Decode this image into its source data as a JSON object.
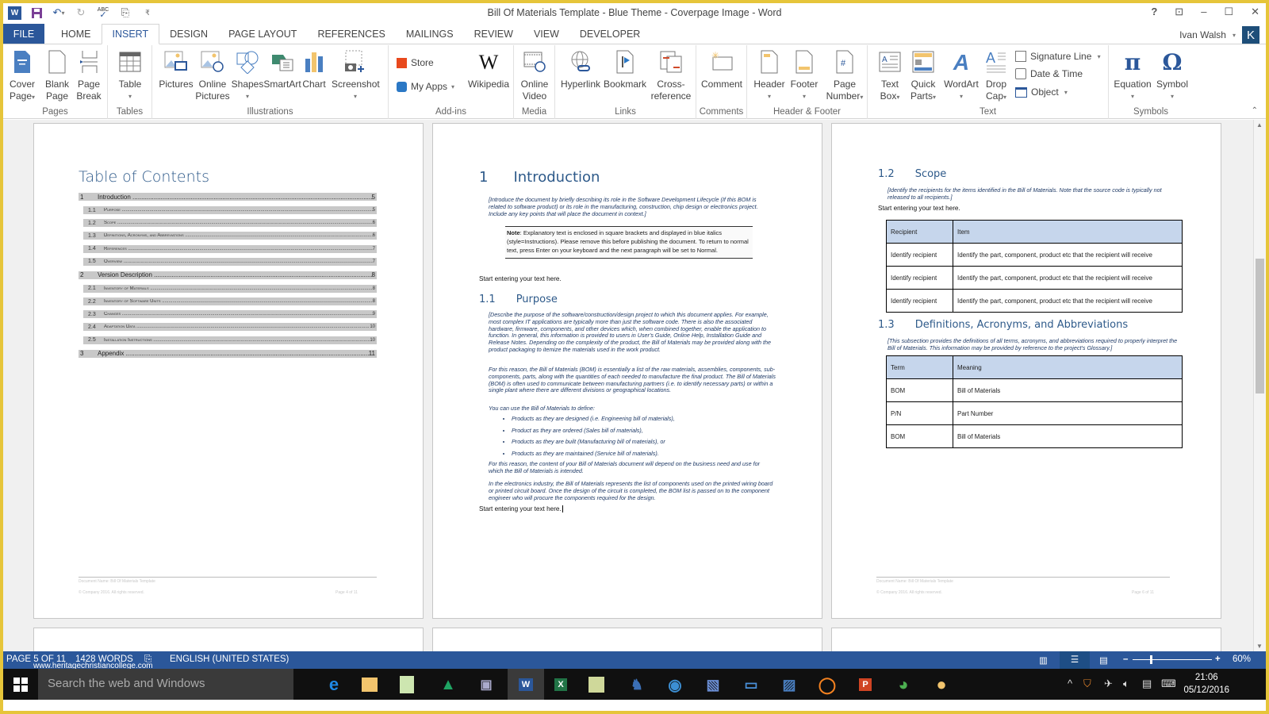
{
  "window": {
    "title": "Bill Of Materials Template - Blue Theme - Coverpage Image - Word",
    "controls": [
      "?",
      "ribbon-display-options",
      "minimize",
      "maximize",
      "close"
    ]
  },
  "qat": {
    "icons": [
      "word-logo",
      "save-icon",
      "undo-icon",
      "redo-icon",
      "spelling-icon",
      "touch-mode-icon",
      "customize-qat-icon"
    ]
  },
  "tabs": [
    "FILE",
    "HOME",
    "INSERT",
    "DESIGN",
    "PAGE LAYOUT",
    "REFERENCES",
    "MAILINGS",
    "REVIEW",
    "VIEW",
    "DEVELOPER"
  ],
  "active_tab": "INSERT",
  "user": {
    "name": "Ivan Walsh",
    "initial": "K"
  },
  "ribbon": {
    "groups": {
      "pages": "Pages",
      "tables": "Tables",
      "illustrations": "Illustrations",
      "addins": "Add-ins",
      "media": "Media",
      "links": "Links",
      "comments": "Comments",
      "header_footer": "Header & Footer",
      "text": "Text",
      "symbols": "Symbols"
    },
    "buttons": {
      "cover_page": [
        "Cover",
        "Page"
      ],
      "blank_page": [
        "Blank",
        "Page"
      ],
      "page_break": [
        "Page",
        "Break"
      ],
      "table": "Table",
      "pictures": "Pictures",
      "online_pictures": [
        "Online",
        "Pictures"
      ],
      "shapes": "Shapes",
      "smartart": "SmartArt",
      "chart": "Chart",
      "screenshot": "Screenshot",
      "store": "Store",
      "my_apps": "My Apps",
      "wikipedia": "Wikipedia",
      "online_video": [
        "Online",
        "Video"
      ],
      "hyperlink": "Hyperlink",
      "bookmark": "Bookmark",
      "cross_reference": [
        "Cross-",
        "reference"
      ],
      "comment": "Comment",
      "header": "Header",
      "footer": "Footer",
      "page_number": [
        "Page",
        "Number"
      ],
      "text_box": [
        "Text",
        "Box"
      ],
      "quick_parts": [
        "Quick",
        "Parts"
      ],
      "wordart": "WordArt",
      "drop_cap": [
        "Drop",
        "Cap"
      ],
      "signature_line": "Signature Line",
      "date_time": "Date & Time",
      "object": "Object",
      "equation": "Equation",
      "symbol": "Symbol"
    }
  },
  "page4": {
    "heading": "Table of Contents",
    "toc": [
      {
        "num": "1",
        "text": "Introduction",
        "page": "5",
        "level": 1
      },
      {
        "num": "1.1",
        "text": "Purpose",
        "page": "5",
        "level": 2
      },
      {
        "num": "1.2",
        "text": "Scope",
        "page": "6",
        "level": 2
      },
      {
        "num": "1.3",
        "text": "Definitions, Acronyms, and Abbreviations",
        "page": "6",
        "level": 2
      },
      {
        "num": "1.4",
        "text": "References",
        "page": "7",
        "level": 2
      },
      {
        "num": "1.5",
        "text": "Overview",
        "page": "7",
        "level": 2
      },
      {
        "num": "2",
        "text": "Version Description",
        "page": "8",
        "level": 1
      },
      {
        "num": "2.1",
        "text": "Inventory of Materials",
        "page": "8",
        "level": 2
      },
      {
        "num": "2.2",
        "text": "Inventory of Software Units",
        "page": "8",
        "level": 2
      },
      {
        "num": "2.3",
        "text": "Changes",
        "page": "9",
        "level": 2
      },
      {
        "num": "2.4",
        "text": "Adaptation Data",
        "page": "10",
        "level": 2
      },
      {
        "num": "2.5",
        "text": "Installation Instructions",
        "page": "10",
        "level": 2
      },
      {
        "num": "3",
        "text": "Appendix",
        "page": "11",
        "level": 1
      }
    ],
    "footer_name": "Document Name: Bill Of Materials Template",
    "footer_copy": "© Company 2016. All rights reserved.",
    "footer_page": "Page 4 of 11"
  },
  "page5": {
    "h1_num": "1",
    "h1_text": "Introduction",
    "intro_instr": "[Introduce the document by briefly describing its role in the Software Development Lifecycle (If this BOM is related to software product) or its role in the manufacturing, construction, chip design or electronics project. Include any key points that will place the document in context.]",
    "note_label": "Note",
    "note_text": ": Explanatory text is enclosed in square brackets and displayed in blue italics (style=Instructions). Please remove this before publishing the document. To return to normal text, press Enter on your keyboard and the next paragraph will be set to Normal.",
    "start_text": "Start entering your text here.",
    "h2_num": "1.1",
    "h2_text": "Purpose",
    "purpose_p1": "[Describe the purpose of the software/construction/design project to which this document applies. For example, most complex IT applications are typically more than just the software code. There is also the associated hardware, firmware, components, and other devices which, when combined together, enable the application to function. In general, this information is provided to users in User's Guide, Online Help, Installation Guide and Release Notes. Depending on the complexity of the product, the Bill of Materials may be provided along with the product packaging to itemize the materials used in the work product.",
    "purpose_p2": "For this reason, the Bill of Materials (BOM) is essentially a list of the raw materials, assemblies, components, sub-components, parts, along with the quantities of each needed to manufacture the final product. The Bill of Materials (BOM) is often used to communicate between manufacturing partners (i.e. to identify necessary parts) or within a single plant where there are different divisions or geographical locations.",
    "purpose_p3": "You can use the Bill of Materials to define:",
    "bullets": [
      "Products as they are designed (i.e. Engineering bill of materials),",
      "Product as they are ordered (Sales bill of materials),",
      "Products as they are built (Manufacturing bill of materials), or",
      "Products as they are maintained (Service bill of materials)."
    ],
    "purpose_p4": "For this reason, the content of your Bill of Materials document will depend on the business need and use for which the Bill of Materials is intended.",
    "purpose_p5": "In the electronics industry, the Bill of Materials represents the list of components used on the printed wiring board or printed circuit board. Once the design of the circuit is completed, the BOM list is passed on to the component engineer who will procure the components required for the design.",
    "start_text2": "Start entering your text here."
  },
  "page6": {
    "scope_num": "1.2",
    "scope_text": "Scope",
    "scope_instr": "[Identify the recipients for the items identified in the Bill of Materials. Note that the source code is typically not released to all recipients.]",
    "start_text": "Start entering your text here.",
    "recipients_table": {
      "headers": [
        "Recipient",
        "Item"
      ],
      "rows": [
        [
          "Identify recipient",
          "Identify the part, component, product etc that the recipient will receive"
        ],
        [
          "Identify recipient",
          "Identify the part, component, product etc that the recipient will receive"
        ],
        [
          "Identify recipient",
          "Identify the part, component, product etc that the recipient will receive"
        ]
      ]
    },
    "defs_num": "1.3",
    "defs_text": "Definitions, Acronyms, and Abbreviations",
    "defs_instr": "[This subsection provides the definitions of all terms, acronyms, and abbreviations required to properly interpret the Bill of Materials. This information may be provided by reference to the project's Glossary.]",
    "terms_table": {
      "headers": [
        "Term",
        "Meaning"
      ],
      "rows": [
        [
          "BOM",
          "Bill of Materials"
        ],
        [
          "P/N",
          "Part Number"
        ],
        [
          "BOM",
          "Bill of Materials"
        ]
      ]
    },
    "footer_name": "Document Name: Bill Of Materials Template",
    "footer_copy": "© Company 2016. All rights reserved.",
    "footer_page": "Page 6 of 11"
  },
  "status": {
    "page": "PAGE 5 OF 11",
    "words": "1428 WORDS",
    "language": "ENGLISH (UNITED STATES)",
    "zoom": "60%",
    "watermark": "www.heritagechristiancollege.com"
  },
  "taskbar": {
    "search_placeholder": "Search the web and Windows",
    "time": "21:06",
    "date": "05/12/2016"
  },
  "colors": {
    "accent": "#2b579a",
    "heading": "#2e5a8a",
    "table_header": "#c6d6ec",
    "instruction_text": "#1f3a66"
  }
}
